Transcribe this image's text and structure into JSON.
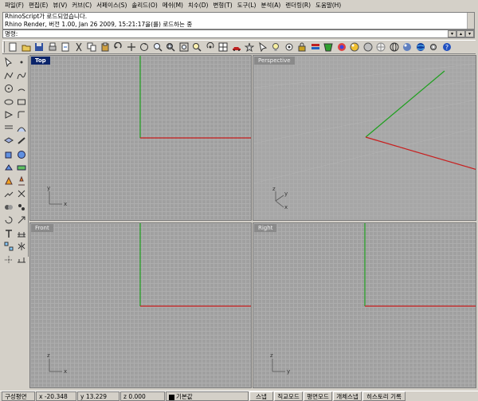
{
  "menu": [
    "파일(F)",
    "편집(E)",
    "뷰(V)",
    "커브(C)",
    "서페이스(S)",
    "솔리드(O)",
    "메쉬(M)",
    "치수(D)",
    "변형(T)",
    "도구(L)",
    "분석(A)",
    "렌더링(R)",
    "도움말(H)"
  ],
  "history": [
    "RhinoScript가 로드되었습니다.",
    "Rhino Render, 버전 1.00, Jan 26 2009, 15:21:17을(를) 로드하는 중"
  ],
  "command": {
    "prompt": "명령:",
    "value": ""
  },
  "toolbar_icons": [
    "new-file-icon",
    "open-file-icon",
    "save-icon",
    "print-icon",
    "import-icon",
    "cut-icon",
    "copy-icon",
    "paste-icon",
    "undo-icon",
    "pan-icon",
    "rotate-view-icon",
    "zoom-dynamic-icon",
    "zoom-window-icon",
    "zoom-extents-icon",
    "zoom-selected-icon",
    "undo-view-icon",
    "four-viewports-icon",
    "car-icon",
    "snap-icon",
    "select-icon",
    "light-icon",
    "hide-icon",
    "lock-icon",
    "layer-icon",
    "properties-icon",
    "render-icon",
    "material-icon",
    "shade-icon",
    "ghost-icon",
    "wireframe-icon",
    "render-sphere-icon",
    "globe-icon",
    "settings-icon",
    "help-icon"
  ],
  "toolbox_icons": [
    [
      "select-arrow-icon",
      "point-icon"
    ],
    [
      "polyline-icon",
      "curve-icon"
    ],
    [
      "circle-icon",
      "arc-icon"
    ],
    [
      "ellipse-icon",
      "rectangle-icon"
    ],
    [
      "polygon-icon",
      "fillet-icon"
    ],
    [
      "offset-icon",
      "surface-icon"
    ],
    [
      "lattice-icon",
      "sweep-icon"
    ],
    [
      "box-icon",
      "sphere-icon"
    ],
    [
      "extrude-icon",
      "mesh-icon"
    ],
    [
      "transform-icon",
      "move-icon"
    ],
    [
      "split-icon",
      "trim-icon"
    ],
    [
      "boolean-icon",
      "group-icon"
    ],
    [
      "rotate-icon",
      "scale-icon"
    ],
    [
      "text-icon",
      "dimension-icon"
    ],
    [
      "array-icon",
      "mirror-icon"
    ],
    [
      "grid-toggle-icon",
      "annotate-icon"
    ]
  ],
  "viewports": [
    {
      "id": "top",
      "title": "Top",
      "active": true,
      "axes": [
        "y",
        "x"
      ]
    },
    {
      "id": "perspective",
      "title": "Perspective",
      "active": false,
      "axes": [
        "z",
        "y",
        "x"
      ]
    },
    {
      "id": "front",
      "title": "Front",
      "active": false,
      "axes": [
        "z",
        "x"
      ]
    },
    {
      "id": "right",
      "title": "Right",
      "active": false,
      "axes": [
        "z",
        "y"
      ]
    }
  ],
  "status": {
    "cplane": "구성평면",
    "x": "x -20.348",
    "y": "y 13.229",
    "z": "z 0.000",
    "layer": "기본값",
    "snap": "스냅",
    "ortho": "직교모드",
    "planar": "평면모드",
    "osnap": "개체스냅",
    "record_history": "히스토리 기록"
  },
  "colors": {
    "x_axis": "#c81e1e",
    "y_axis": "#1ea01e",
    "active_title": "#0b246a"
  }
}
